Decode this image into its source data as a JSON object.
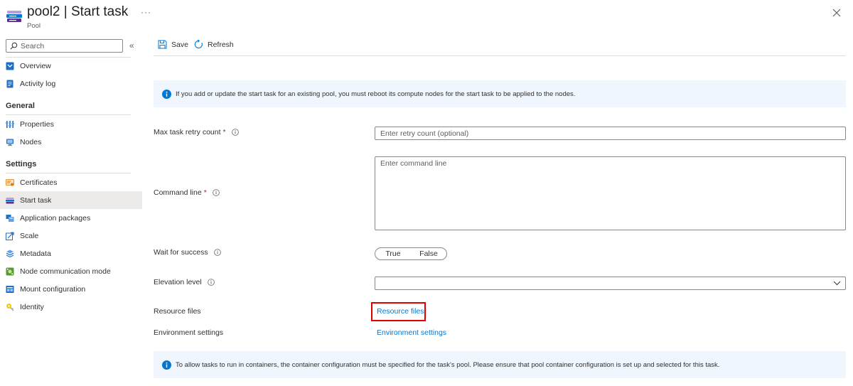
{
  "header": {
    "title": "pool2 | Start task",
    "subtitle": "Pool",
    "more_label": "···",
    "logo_icon": "batch-pool-icon",
    "close_icon": "close-icon"
  },
  "sidebar": {
    "search_placeholder": "Search",
    "collapse_label": "«",
    "top_items": [
      {
        "label": "Overview",
        "icon": "overview-icon"
      },
      {
        "label": "Activity log",
        "icon": "activity-log-icon"
      }
    ],
    "groups": [
      {
        "title": "General",
        "items": [
          {
            "label": "Properties",
            "icon": "properties-icon"
          },
          {
            "label": "Nodes",
            "icon": "nodes-icon"
          }
        ]
      },
      {
        "title": "Settings",
        "items": [
          {
            "label": "Certificates",
            "icon": "certificates-icon"
          },
          {
            "label": "Start task",
            "icon": "start-task-icon",
            "active": true
          },
          {
            "label": "Application packages",
            "icon": "application-packages-icon"
          },
          {
            "label": "Scale",
            "icon": "scale-icon"
          },
          {
            "label": "Metadata",
            "icon": "metadata-icon"
          },
          {
            "label": "Node communication mode",
            "icon": "node-communication-icon"
          },
          {
            "label": "Mount configuration",
            "icon": "mount-configuration-icon"
          },
          {
            "label": "Identity",
            "icon": "identity-icon"
          }
        ]
      }
    ]
  },
  "toolbar": {
    "save_label": "Save",
    "refresh_label": "Refresh"
  },
  "banners": {
    "top": "If you add or update the start task for an existing pool, you must reboot its compute nodes for the start task to be applied to the nodes.",
    "bottom": "To allow tasks to run in containers, the container configuration must be specified for the task's pool. Please ensure that pool container configuration is set up and selected for this task."
  },
  "form": {
    "retry": {
      "label": "Max task retry count",
      "required_mark": "*",
      "placeholder": "Enter retry count (optional)",
      "value": ""
    },
    "command_line": {
      "label": "Command line",
      "required_mark": "*",
      "placeholder": "Enter command line",
      "value": ""
    },
    "wait_for_success": {
      "label": "Wait for success",
      "options": [
        "True",
        "False"
      ],
      "selected": null
    },
    "elevation_level": {
      "label": "Elevation level",
      "value": ""
    },
    "resource_files": {
      "label": "Resource files",
      "link": "Resource files"
    },
    "environment_settings": {
      "label": "Environment settings",
      "link": "Environment settings"
    }
  },
  "colors": {
    "accent": "#0078d4",
    "highlight": "#e00000",
    "required": "#a4262c",
    "banner_bg": "#f0f6fd",
    "active_nav_bg": "#edebe9"
  }
}
